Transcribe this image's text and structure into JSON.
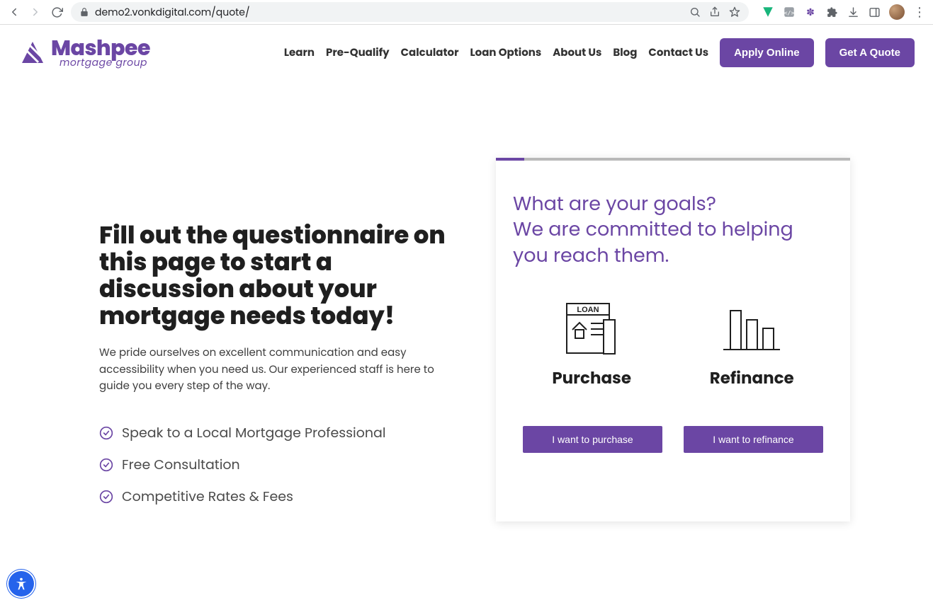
{
  "browser": {
    "url": "demo2.vonkdigital.com/quote/"
  },
  "logo": {
    "main": "Mashpee",
    "sub": "mortgage group"
  },
  "nav": {
    "items": [
      {
        "label": "Learn"
      },
      {
        "label": "Pre-Qualify"
      },
      {
        "label": "Calculator"
      },
      {
        "label": "Loan Options"
      },
      {
        "label": "About Us"
      },
      {
        "label": "Blog"
      },
      {
        "label": "Contact Us"
      }
    ],
    "apply_label": "Apply Online",
    "quote_label": "Get A Quote"
  },
  "hero": {
    "heading": "Fill out the questionnaire on this page to start a discussion about your mortgage needs today!",
    "sub": "We pride ourselves on excellent communication and easy accessibility when you need us. Our experienced staff is here to guide you every step of the way.",
    "features": [
      "Speak to a Local Mortgage Professional",
      "Free Consultation",
      "Competitive Rates & Fees"
    ]
  },
  "card": {
    "heading_line1": "What are your goals?",
    "heading_line2": "We are committed to helping you reach them.",
    "options": {
      "purchase": {
        "label": "Purchase",
        "button": "I want to purchase"
      },
      "refinance": {
        "label": "Refinance",
        "button": "I want to refinance"
      }
    }
  },
  "colors": {
    "accent": "#6b46a4"
  }
}
